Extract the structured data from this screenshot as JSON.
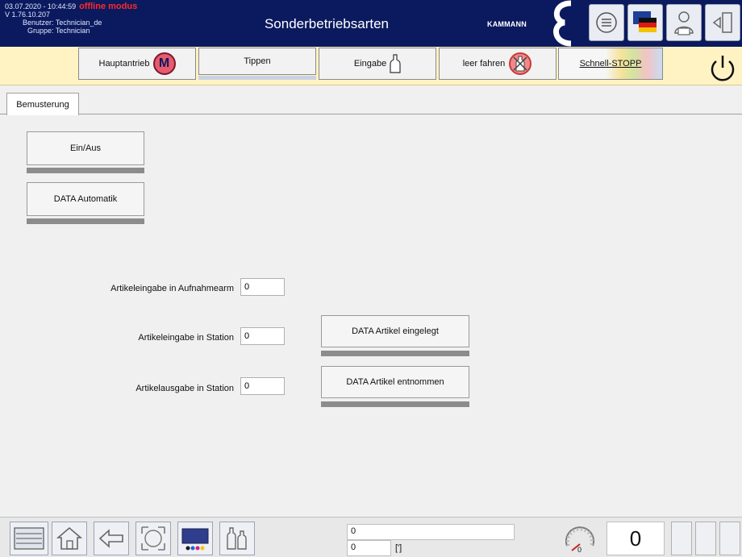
{
  "header": {
    "datetime": "03.07.2020 - 10:44:59",
    "mode": "offline modus",
    "version": "V 1.76.10.207",
    "user": "Benutzer: Technician_de",
    "group": "Gruppe: Technician",
    "title": "Sonderbetriebsarten",
    "brand": "KAMMANN"
  },
  "funcbar": {
    "main_drive": "Hauptantrieb",
    "main_drive_badge": "M",
    "jog": "Tippen",
    "input": "Eingabe",
    "empty_run": "leer fahren",
    "quick_stop": "Schnell-STOPP"
  },
  "tabs": [
    {
      "label": "Bemusterung"
    }
  ],
  "main": {
    "on_off": "Ein/Aus",
    "data_auto": "DATA Automatik",
    "article_input_arm_label": "Artikeleingabe in Aufnahmearm",
    "article_input_arm_value": "0",
    "article_input_station_label": "Artikeleingabe in Station",
    "article_input_station_value": "0",
    "article_output_station_label": "Artikelausgabe in Station",
    "article_output_station_value": "0",
    "data_inserted": "DATA Artikel eingelegt",
    "data_removed": "DATA Artikel entnommen"
  },
  "bottom": {
    "field1": "0",
    "field2": "0",
    "unit": "[']",
    "gauge_value": "0",
    "counter": "0"
  },
  "colors": {
    "header_bg": "#0b1a5e",
    "funcbar_bg": "#fff3c4",
    "offline": "#ff2a2a"
  }
}
